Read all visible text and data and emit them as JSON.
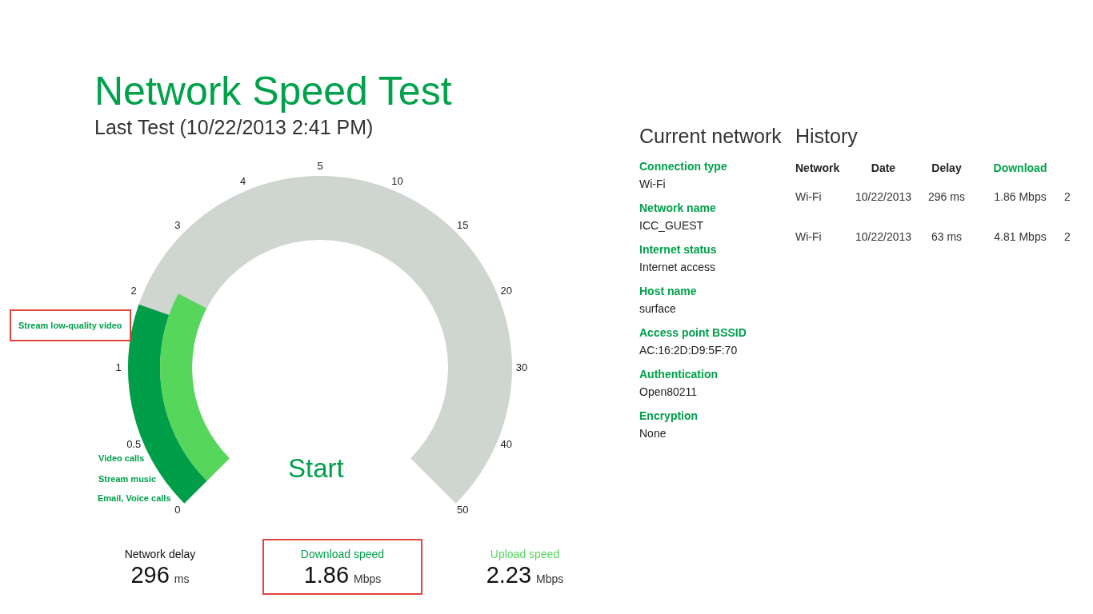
{
  "title": "Network Speed Test",
  "subtitle": "Last Test (10/22/2013 2:41 PM)",
  "gauge": {
    "ticks": [
      "0",
      "0.5",
      "1",
      "2",
      "3",
      "4",
      "5",
      "10",
      "15",
      "20",
      "30",
      "40",
      "50"
    ],
    "activities": [
      {
        "label": "Stream low-quality video",
        "highlighted": true
      },
      {
        "label": "Video calls",
        "highlighted": false
      },
      {
        "label": "Stream music",
        "highlighted": false
      },
      {
        "label": "Email, Voice calls",
        "highlighted": false
      }
    ],
    "download": {
      "level": 0.238
    },
    "upload": {
      "level": 0.269
    },
    "start_button": "Start"
  },
  "stats": [
    {
      "label": "Network delay",
      "value": "296",
      "unit": "ms",
      "color": "#111111",
      "highlighted": false
    },
    {
      "label": "Download speed",
      "value": "1.86",
      "unit": "Mbps",
      "color": "#00a14b",
      "highlighted": true
    },
    {
      "label": "Upload speed",
      "value": "2.23",
      "unit": "Mbps",
      "color": "#56d65a",
      "highlighted": false
    }
  ],
  "current_network": {
    "title": "Current network",
    "fields": [
      {
        "label": "Connection type",
        "value": "Wi-Fi"
      },
      {
        "label": "Network name",
        "value": "ICC_GUEST"
      },
      {
        "label": "Internet status",
        "value": "Internet access"
      },
      {
        "label": "Host name",
        "value": "surface"
      },
      {
        "label": "Access point BSSID",
        "value": "AC:16:2D:D9:5F:70"
      },
      {
        "label": "Authentication",
        "value": "Open80211"
      },
      {
        "label": "Encryption",
        "value": "None"
      }
    ]
  },
  "history": {
    "title": "History",
    "columns": [
      {
        "label": "Network",
        "selected": false
      },
      {
        "label": "Date",
        "selected": false
      },
      {
        "label": "Delay",
        "selected": false
      },
      {
        "label": "Download",
        "selected": true
      }
    ],
    "rows": [
      [
        "Wi-Fi",
        "10/22/2013",
        "296 ms",
        "1.86 Mbps",
        "2"
      ],
      [
        "Wi-Fi",
        "10/22/2013",
        "63 ms",
        "4.81 Mbps",
        "2"
      ]
    ]
  }
}
